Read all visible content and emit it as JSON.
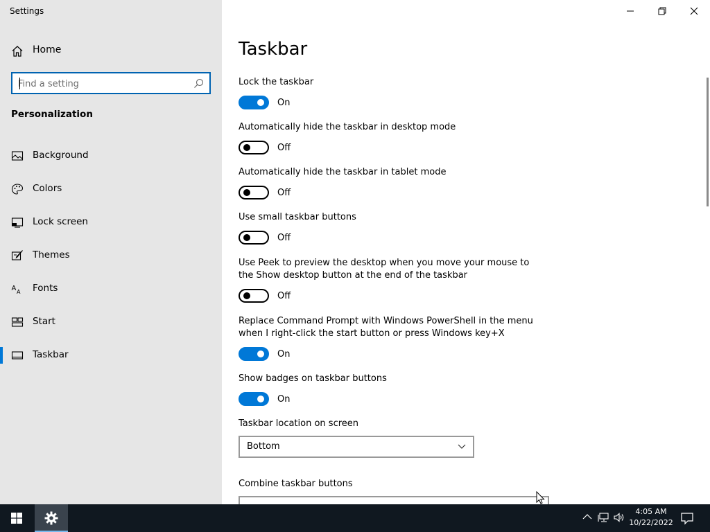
{
  "window": {
    "title": "Settings",
    "controls": {
      "minimize": "minimize-icon",
      "restore": "restore-icon",
      "close": "close-icon"
    }
  },
  "sidebar": {
    "home_label": "Home",
    "search": {
      "placeholder": "Find a setting",
      "value": ""
    },
    "section_title": "Personalization",
    "items": [
      {
        "label": "Background",
        "icon": "background-icon",
        "selected": false
      },
      {
        "label": "Colors",
        "icon": "palette-icon",
        "selected": false
      },
      {
        "label": "Lock screen",
        "icon": "lock-screen-icon",
        "selected": false
      },
      {
        "label": "Themes",
        "icon": "themes-icon",
        "selected": false
      },
      {
        "label": "Fonts",
        "icon": "fonts-icon",
        "selected": false
      },
      {
        "label": "Start",
        "icon": "start-icon",
        "selected": false
      },
      {
        "label": "Taskbar",
        "icon": "taskbar-icon",
        "selected": true
      }
    ]
  },
  "content": {
    "title": "Taskbar",
    "settings": [
      {
        "label": "Lock the taskbar",
        "state": "On"
      },
      {
        "label": "Automatically hide the taskbar in desktop mode",
        "state": "Off"
      },
      {
        "label": "Automatically hide the taskbar in tablet mode",
        "state": "Off"
      },
      {
        "label": "Use small taskbar buttons",
        "state": "Off"
      },
      {
        "label": "Use Peek to preview the desktop when you move your mouse to the Show desktop button at the end of the taskbar",
        "state": "Off"
      },
      {
        "label": "Replace Command Prompt with Windows PowerShell in the menu when I right-click the start button or press Windows key+X",
        "state": "On"
      },
      {
        "label": "Show badges on taskbar buttons",
        "state": "On"
      }
    ],
    "location": {
      "label": "Taskbar location on screen",
      "value": "Bottom"
    },
    "combine": {
      "label": "Combine taskbar buttons"
    }
  },
  "taskbar": {
    "clock_time": "4:05 AM",
    "clock_date": "10/22/2022"
  },
  "colors": {
    "accent": "#0078d7",
    "sidebar_bg": "#e6e6e6",
    "taskbar_bg": "#101820"
  }
}
